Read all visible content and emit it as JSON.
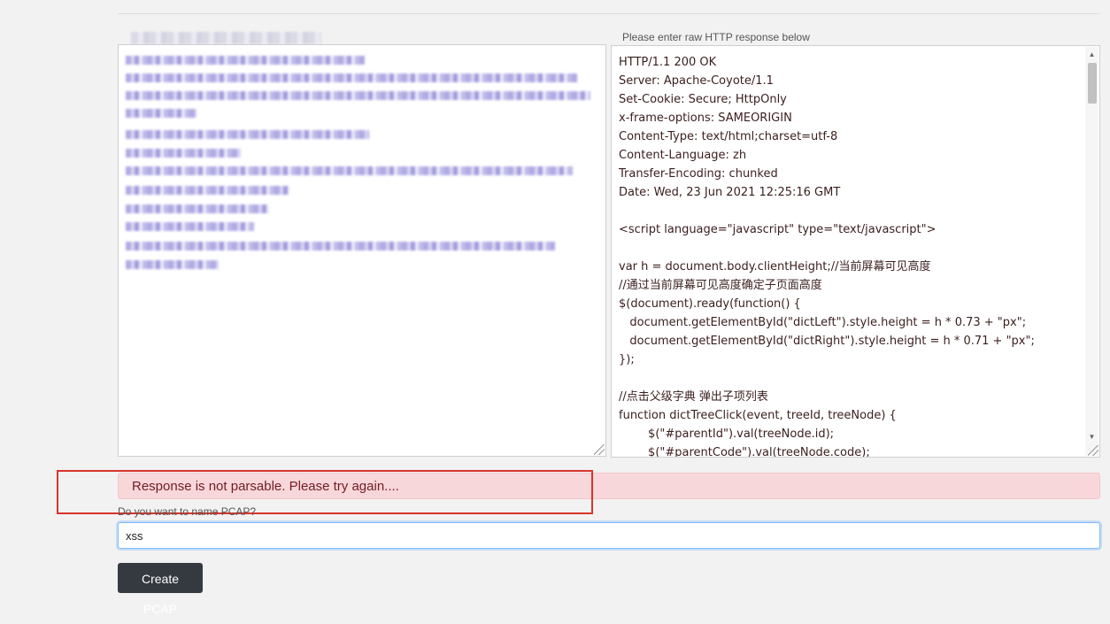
{
  "response_panel": {
    "label": "Please enter raw HTTP response below",
    "lines": [
      "HTTP/1.1 200 OK",
      "Server: Apache-Coyote/1.1",
      "Set-Cookie: Secure; HttpOnly",
      "x-frame-options: SAMEORIGIN",
      "Content-Type: text/html;charset=utf-8",
      "Content-Language: zh",
      "Transfer-Encoding: chunked",
      "Date: Wed, 23 Jun 2021 12:25:16 GMT",
      "",
      "<script language=\"javascript\" type=\"text/javascript\">",
      "",
      "var h = document.body.clientHeight;//当前屏幕可见高度",
      "//通过当前屏幕可见高度确定子页面高度",
      "$(document).ready(function() {",
      "   document.getElementById(\"dictLeft\").style.height = h * 0.73 + \"px\";",
      "   document.getElementById(\"dictRight\").style.height = h * 0.71 + \"px\";",
      "});",
      "",
      "//点击父级字典 弹出子项列表",
      "function dictTreeClick(event, treeId, treeNode) {",
      "        $(\"#parentId\").val(treeNode.id);",
      "        $(\"#parentCode\").val(treeNode.code);"
    ]
  },
  "alert": {
    "message": "Response is not parsable. Please try again...."
  },
  "pcap": {
    "label": "Do you want to name PCAP?",
    "value": "xss",
    "button_label": "Create PCAP"
  },
  "colors": {
    "alert_bg": "#f8d7da",
    "alert_text": "#721c24",
    "highlight_border": "#d9342b",
    "button_bg": "#343a40"
  }
}
